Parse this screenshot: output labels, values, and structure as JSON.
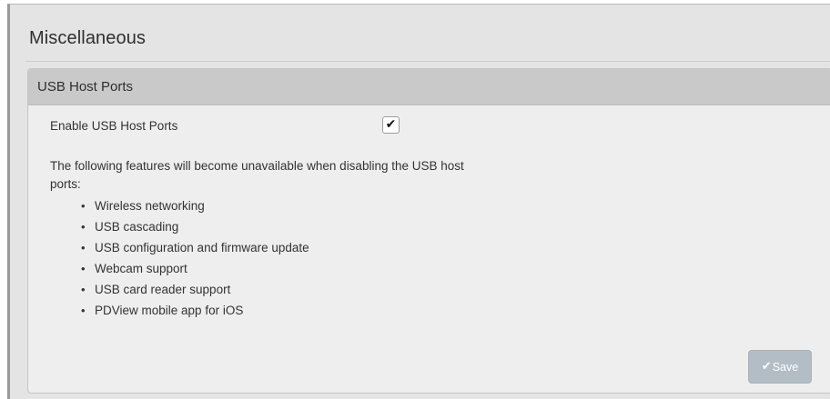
{
  "page": {
    "title": "Miscellaneous"
  },
  "panel": {
    "header": "USB Host Ports",
    "enable_label": "Enable USB Host Ports",
    "enable_checked": true,
    "checkmark": "✔",
    "description": "The following features will become unavailable when disabling the USB host ports:",
    "features": [
      "Wireless networking",
      "USB cascading",
      "USB configuration and firmware update",
      "Webcam support",
      "USB card reader support",
      "PDView mobile app for iOS"
    ],
    "save_label": "Save",
    "save_icon": "✔"
  },
  "colors": {
    "panel_header_bg": "#c9c9c9",
    "save_button_disabled": "#b3bdc5"
  }
}
